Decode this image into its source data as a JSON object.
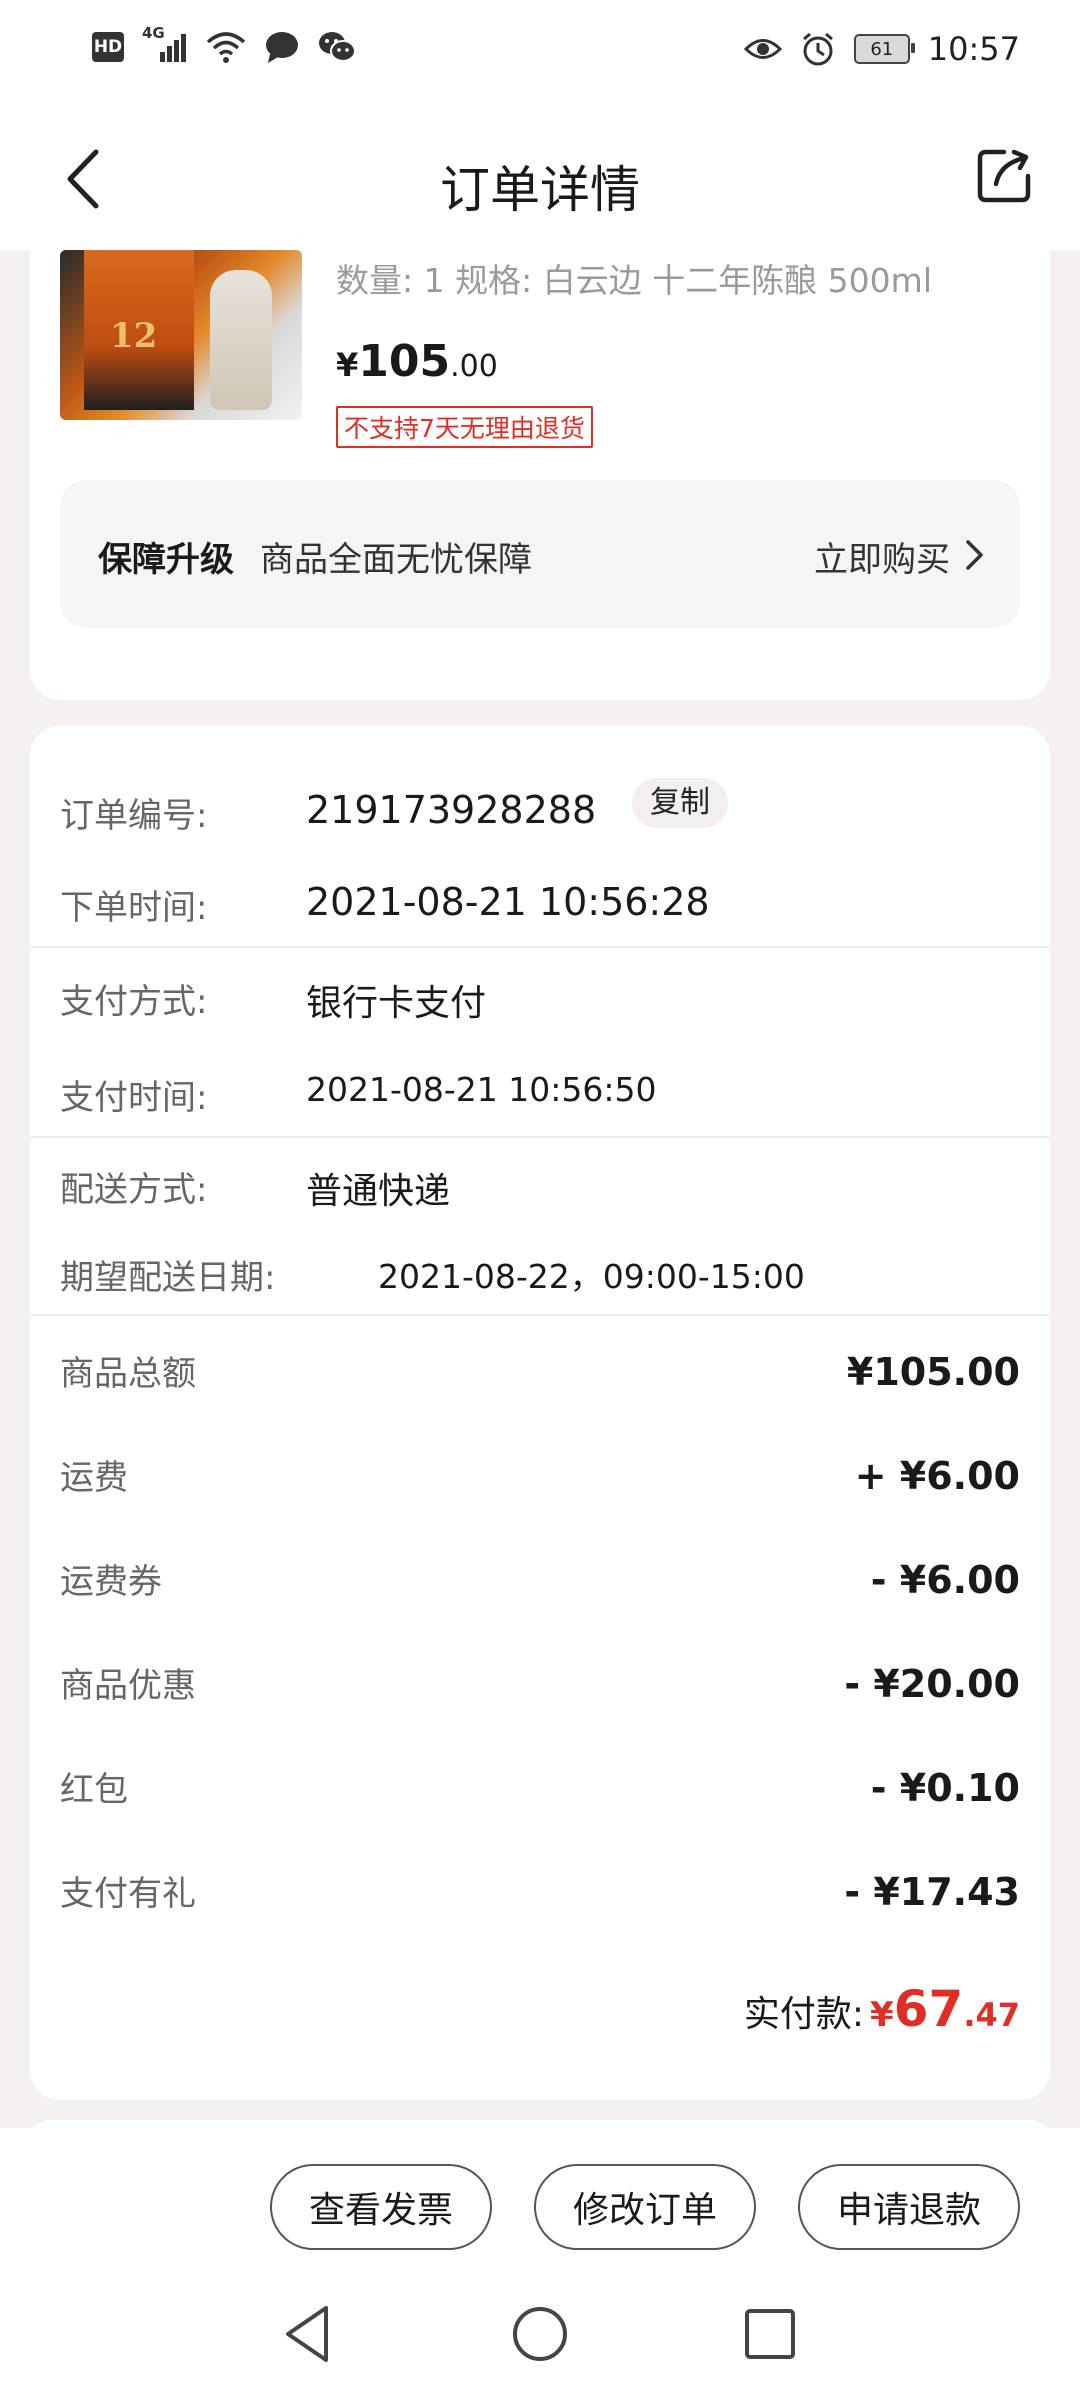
{
  "status_bar": {
    "hd": "HD",
    "network": "4G",
    "battery": "61",
    "time": "10:57",
    "icons": [
      "signal-icon",
      "wifi-icon",
      "message-icon",
      "wechat-icon",
      "eye-icon",
      "alarm-icon",
      "battery-icon"
    ]
  },
  "header": {
    "title": "订单详情",
    "icons": [
      "back-arrow-icon",
      "share-icon"
    ]
  },
  "product": {
    "spec": "数量: 1   规格: 白云边 十二年陈酿 500ml",
    "price_symbol": "¥",
    "price_int": "105",
    "price_dec": ".00",
    "no_return_badge": "不支持7天无理由退货",
    "image_text": "12"
  },
  "guarantee": {
    "title": "保障升级",
    "desc": "商品全面无忧保障",
    "action": "立即购买"
  },
  "order_info": {
    "order_no_label": "订单编号:",
    "order_no": "219173928288",
    "copy_label": "复制",
    "order_time_label": "下单时间:",
    "order_time": "2021-08-21 10:56:28",
    "pay_method_label": "支付方式:",
    "pay_method": "银行卡支付",
    "pay_time_label": "支付时间:",
    "pay_time": "2021-08-21 10:56:50",
    "delivery_label": "配送方式:",
    "delivery": "普通快递",
    "expected_label": "期望配送日期:",
    "expected": "2021-08-22，09:00-15:00"
  },
  "amounts": [
    {
      "label": "商品总额",
      "value": "¥105.00"
    },
    {
      "label": "运费",
      "value": "+ ¥6.00"
    },
    {
      "label": "运费券",
      "value": "- ¥6.00"
    },
    {
      "label": "商品优惠",
      "value": "- ¥20.00"
    },
    {
      "label": "红包",
      "value": "- ¥0.10"
    },
    {
      "label": "支付有礼",
      "value": "- ¥17.43"
    }
  ],
  "paid": {
    "label": "实付款:",
    "symbol": "¥",
    "int": "67",
    "dec": ".47",
    "color": "#e02e24"
  },
  "actions": {
    "invoice": "查看发票",
    "modify": "修改订单",
    "refund": "申请退款"
  },
  "nav": {
    "icons": [
      "back-triangle-icon",
      "home-circle-icon",
      "recent-square-icon"
    ]
  }
}
